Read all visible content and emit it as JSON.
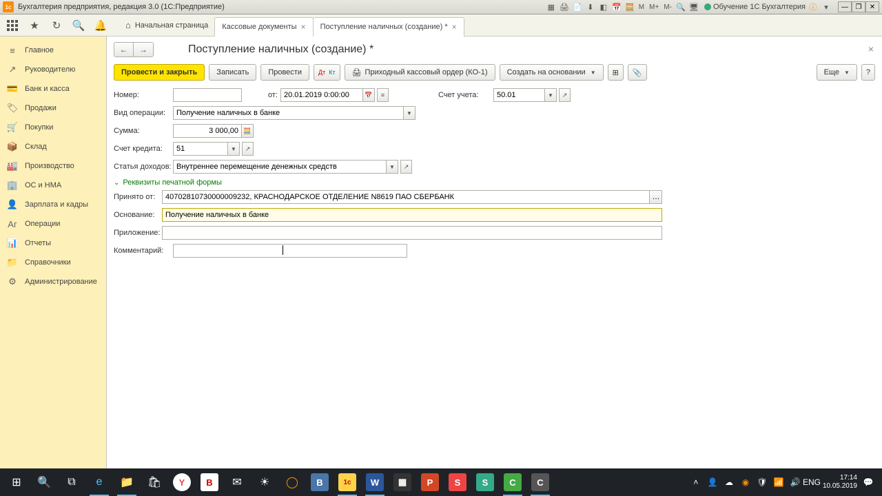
{
  "title_bar": {
    "app_label": "1c",
    "title": "Бухгалтерия предприятия, редакция 3.0 (1С:Предприятие)",
    "m_labels": [
      "M",
      "M+",
      "M-"
    ],
    "learn_label": "Обучение 1С Бухгалтерия"
  },
  "tabs": {
    "home": "Начальная страница",
    "t1": "Кассовые документы",
    "t2": "Поступление наличных (создание) *"
  },
  "sidebar": [
    {
      "icon": "≡",
      "label": "Главное"
    },
    {
      "icon": "↗",
      "label": "Руководителю"
    },
    {
      "icon": "💳",
      "label": "Банк и касса"
    },
    {
      "icon": "🏷",
      "label": "Продажи"
    },
    {
      "icon": "🛒",
      "label": "Покупки"
    },
    {
      "icon": "📦",
      "label": "Склад"
    },
    {
      "icon": "🏭",
      "label": "Производство"
    },
    {
      "icon": "🏢",
      "label": "ОС и НМА"
    },
    {
      "icon": "👤",
      "label": "Зарплата и кадры"
    },
    {
      "icon": "Аг",
      "label": "Операции"
    },
    {
      "icon": "📊",
      "label": "Отчеты"
    },
    {
      "icon": "📁",
      "label": "Справочники"
    },
    {
      "icon": "⚙",
      "label": "Администрирование"
    }
  ],
  "page": {
    "title": "Поступление наличных (создание) *",
    "actions": {
      "post_close": "Провести и закрыть",
      "save": "Записать",
      "post": "Провести",
      "print_order": "Приходный кассовый ордер (КО-1)",
      "create_based": "Создать на основании",
      "more": "Еще",
      "help": "?"
    },
    "form": {
      "number_label": "Номер:",
      "number_value": "",
      "date_label": "от:",
      "date_value": "20.01.2019 0:00:00",
      "account_label": "Счет учета:",
      "account_value": "50.01",
      "op_type_label": "Вид операции:",
      "op_type_value": "Получение наличных в банке",
      "sum_label": "Сумма:",
      "sum_value": "3 000,00",
      "credit_label": "Счет кредита:",
      "credit_value": "51",
      "income_label": "Статья доходов:",
      "income_value": "Внутреннее перемещение денежных средств",
      "section_title": "Реквизиты печатной формы",
      "received_from_label": "Принято от:",
      "received_from_value": "40702810730000009232, КРАСНОДАРСКОЕ ОТДЕЛЕНИЕ N8619 ПАО СБЕРБАНК",
      "basis_label": "Основание:",
      "basis_value": "Получение наличных в банке",
      "attachment_label": "Приложение:",
      "attachment_value": "",
      "comment_label": "Комментарий:",
      "comment_value": ""
    }
  },
  "taskbar": {
    "time": "17:14",
    "date": "10.05.2019",
    "lang": "ENG"
  }
}
